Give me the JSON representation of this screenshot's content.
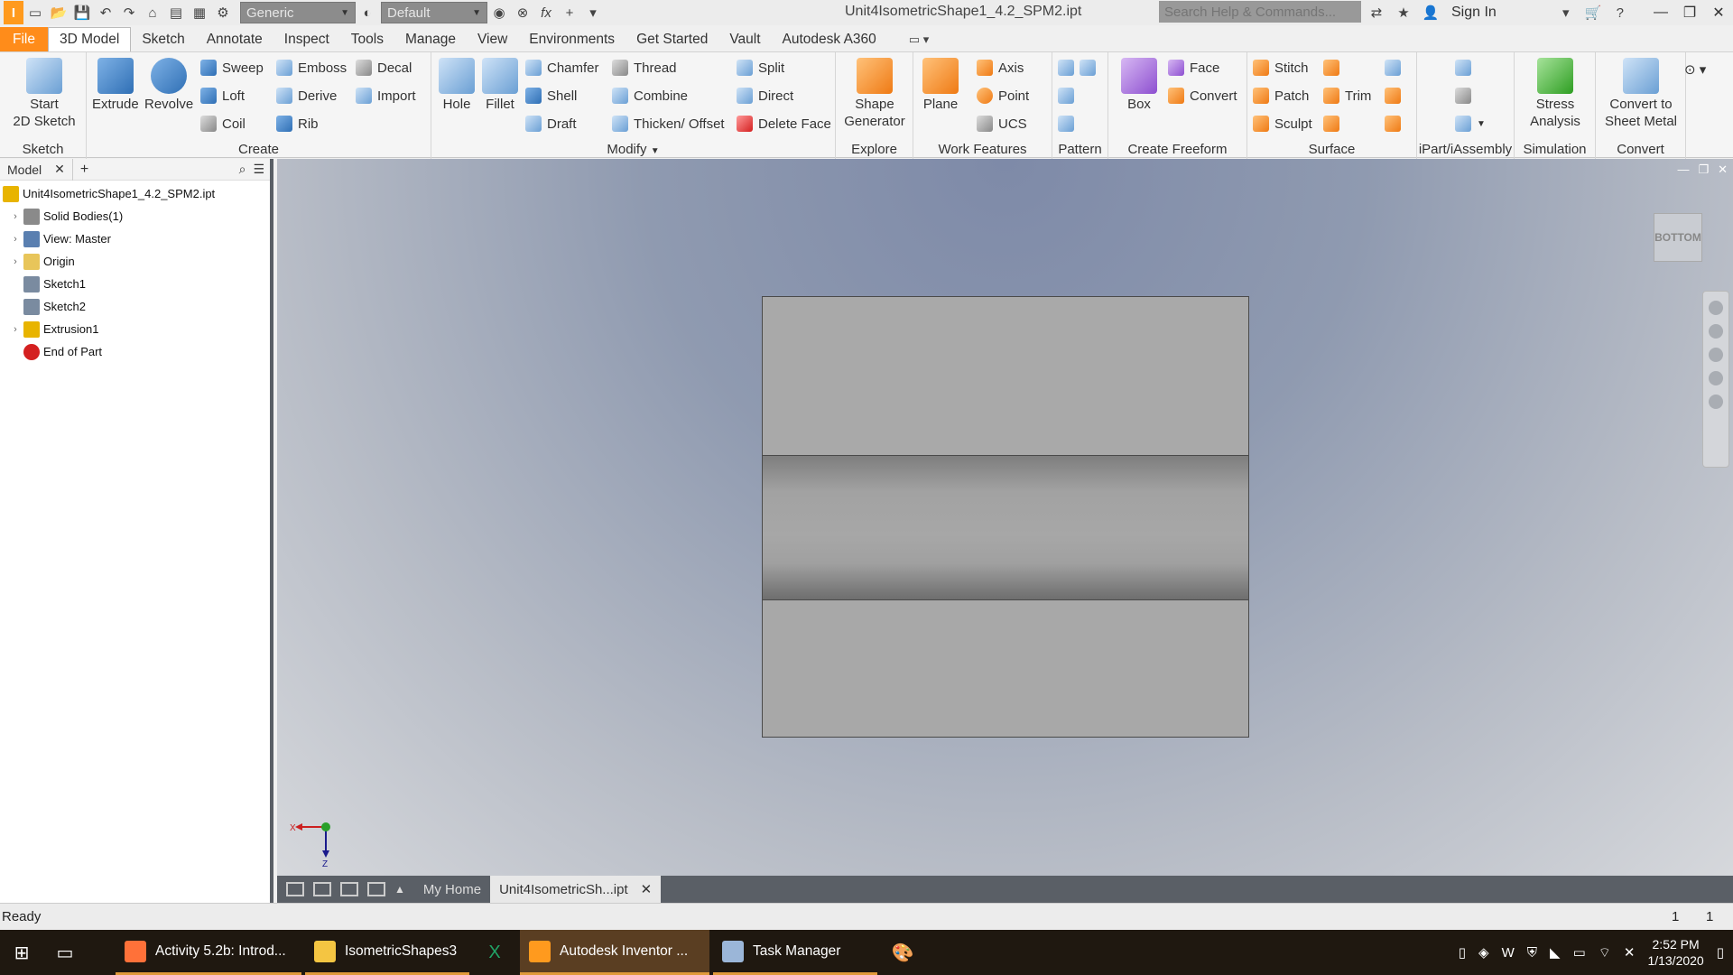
{
  "titlebar": {
    "material": "Generic",
    "appearance": "Default",
    "doc_title": "Unit4IsometricShape1_4.2_SPM2.ipt",
    "search_placeholder": "Search Help & Commands...",
    "signin": "Sign In"
  },
  "ribbon_tabs": [
    "File",
    "3D Model",
    "Sketch",
    "Annotate",
    "Inspect",
    "Tools",
    "Manage",
    "View",
    "Environments",
    "Get Started",
    "Vault",
    "Autodesk A360"
  ],
  "ribbon": {
    "sketch": {
      "label": "Sketch",
      "start": "Start\n2D Sketch"
    },
    "create": {
      "label": "Create",
      "extrude": "Extrude",
      "revolve": "Revolve",
      "sweep": "Sweep",
      "loft": "Loft",
      "coil": "Coil",
      "emboss": "Emboss",
      "derive": "Derive",
      "rib": "Rib",
      "decal": "Decal",
      "import": "Import"
    },
    "modify": {
      "label": "Modify",
      "hole": "Hole",
      "fillet": "Fillet",
      "chamfer": "Chamfer",
      "shell": "Shell",
      "draft": "Draft",
      "thread": "Thread",
      "combine": "Combine",
      "thicken": "Thicken/ Offset",
      "split": "Split",
      "direct": "Direct",
      "delete_face": "Delete Face"
    },
    "explore": {
      "label": "Explore",
      "shape_generator": "Shape\nGenerator"
    },
    "work_features": {
      "label": "Work Features",
      "plane": "Plane",
      "axis": "Axis",
      "point": "Point",
      "ucs": "UCS"
    },
    "pattern": {
      "label": "Pattern"
    },
    "freeform": {
      "label": "Create Freeform",
      "box": "Box",
      "face": "Face",
      "convert": "Convert"
    },
    "surface": {
      "label": "Surface",
      "stitch": "Stitch",
      "patch": "Patch",
      "sculpt": "Sculpt",
      "trim": "Trim"
    },
    "ipart": {
      "label": "iPart/iAssembly"
    },
    "simulation": {
      "label": "Simulation",
      "stress": "Stress\nAnalysis"
    },
    "convert": {
      "label": "Convert",
      "sheet_metal": "Convert to\nSheet Metal"
    }
  },
  "browser": {
    "tab": "Model",
    "tree": [
      {
        "label": "Unit4IsometricShape1_4.2_SPM2.ipt",
        "icon": "part-icon",
        "expander": false
      },
      {
        "label": "Solid Bodies(1)",
        "icon": "solid-bodies-icon",
        "expander": true
      },
      {
        "label": "View: Master",
        "icon": "view-icon",
        "expander": true
      },
      {
        "label": "Origin",
        "icon": "folder-icon",
        "expander": true
      },
      {
        "label": "Sketch1",
        "icon": "sketch-icon",
        "expander": false
      },
      {
        "label": "Sketch2",
        "icon": "sketch-icon",
        "expander": false
      },
      {
        "label": "Extrusion1",
        "icon": "extrusion-icon",
        "expander": true
      },
      {
        "label": "End of Part",
        "icon": "end-of-part-icon",
        "expander": false
      }
    ]
  },
  "viewport": {
    "viewcube": "BOTTOM",
    "triad_x": "X",
    "triad_z": "Z"
  },
  "doc_tabs": {
    "home": "My Home",
    "active": "Unit4IsometricSh...ipt"
  },
  "status": {
    "text": "Ready",
    "num1": "1",
    "num2": "1"
  },
  "taskbar": {
    "apps": [
      {
        "label": "Activity 5.2b: Introd...",
        "icon": "firefox-icon",
        "color": "#ff7139",
        "active": false
      },
      {
        "label": "IsometricShapes3",
        "icon": "folder-icon",
        "color": "#f4c542",
        "active": false
      },
      {
        "label": "Autodesk Inventor ...",
        "icon": "inventor-icon",
        "color": "#ff9a1e",
        "active": true
      },
      {
        "label": "Task Manager",
        "icon": "task-manager-icon",
        "color": "#9bb6d8",
        "active": false
      }
    ],
    "time": "2:52 PM",
    "date": "1/13/2020"
  }
}
